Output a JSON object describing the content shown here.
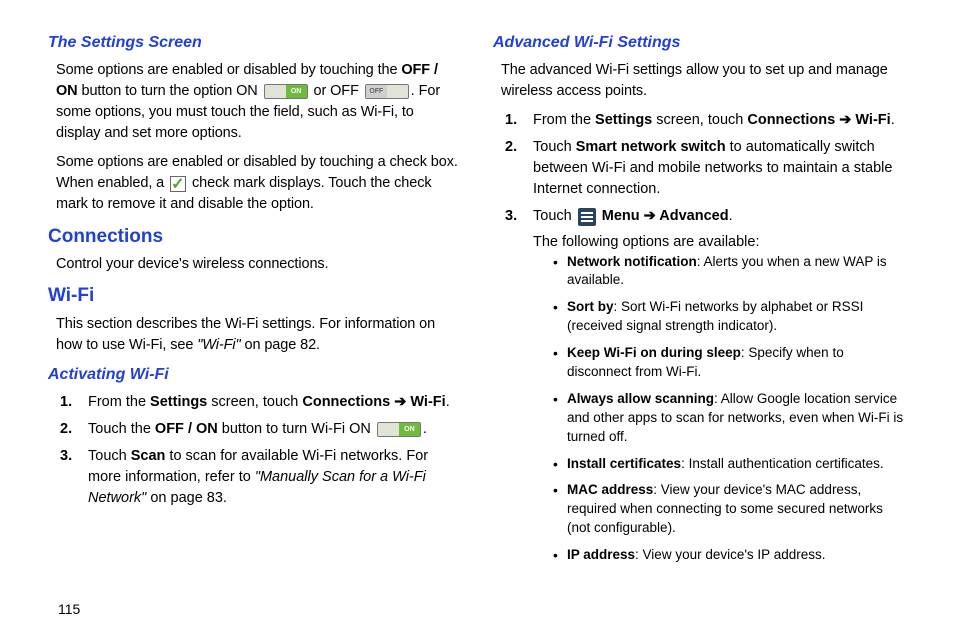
{
  "page_number": "115",
  "left": {
    "h1": "The Settings Screen",
    "p1_pre": "Some options are enabled or disabled by touching the ",
    "p1_offon": "OFF / ON",
    "p1_mid1": " button to turn the option ON ",
    "p1_mid2": " or OFF ",
    "p1_post": ". For some options, you must touch the field, such as Wi-Fi, to display and set more options.",
    "p2_pre": "Some options are enabled or disabled by touching a check box. When enabled, a ",
    "p2_post": " check mark displays. Touch the check mark to remove it and disable the option.",
    "h2": "Connections",
    "p3": "Control your device's wireless connections.",
    "h3": "Wi-Fi",
    "p4_pre": "This section describes the Wi-Fi settings. For information on how to use Wi-Fi, see ",
    "p4_ref": "\"Wi-Fi\"",
    "p4_post": " on page 82.",
    "h4": "Activating Wi-Fi",
    "s1_pre": "From the ",
    "s1_settings": "Settings",
    "s1_mid": " screen, touch ",
    "s1_conn": "Connections ➔ Wi-Fi",
    "s1_post": ".",
    "s2_pre": "Touch the ",
    "s2_offon": "OFF / ON",
    "s2_mid": " button to turn Wi-Fi ON ",
    "s2_post": ".",
    "s3_pre": "Touch ",
    "s3_scan": "Scan",
    "s3_mid": " to scan for available Wi-Fi networks. For more information, refer to ",
    "s3_ref": "\"Manually Scan for a Wi-Fi Network\"",
    "s3_post": " on page 83."
  },
  "right": {
    "h1": "Advanced Wi-Fi Settings",
    "p1": "The advanced Wi-Fi settings allow you to set up and manage wireless access points.",
    "s1_pre": "From the ",
    "s1_settings": "Settings",
    "s1_mid": " screen, touch ",
    "s1_conn": "Connections ➔ Wi-Fi",
    "s1_post": ".",
    "s2_pre": "Touch ",
    "s2_sns": "Smart network switch",
    "s2_post": " to automatically switch between Wi-Fi and mobile networks to maintain a stable Internet connection.",
    "s3_pre": "Touch ",
    "s3_menuadv": "Menu ➔ Advanced",
    "s3_post": ".",
    "s3_line2": "The following options are available:",
    "b1_label": "Network notification",
    "b1_text": ": Alerts you when a new WAP is available.",
    "b2_label": "Sort by",
    "b2_text": ": Sort Wi-Fi networks by alphabet or RSSI (received signal strength indicator).",
    "b3_label": "Keep Wi-Fi on during sleep",
    "b3_text": ": Specify when to disconnect from Wi-Fi.",
    "b4_label": "Always allow scanning",
    "b4_text": ": Allow Google location service and other apps to scan for networks, even when Wi-Fi is turned off.",
    "b5_label": "Install certificates",
    "b5_text": ": Install authentication certificates.",
    "b6_label": "MAC address",
    "b6_text": ": View your device's MAC address, required when connecting to some secured networks (not configurable).",
    "b7_label": "IP address",
    "b7_text": ": View your device's IP address."
  }
}
